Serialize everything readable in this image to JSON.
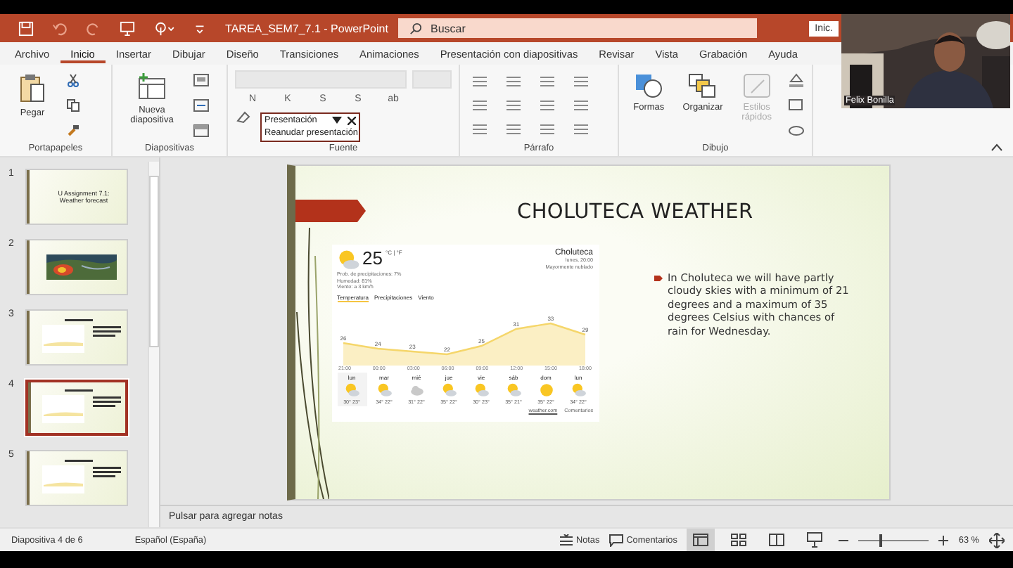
{
  "title_bar": {
    "title": "TAREA_SEM7_7.1 - PowerPoint",
    "search": {
      "placeholder": "Buscar"
    },
    "account_button": "Inic."
  },
  "menu_tabs": [
    {
      "label": "Archivo",
      "selected": false
    },
    {
      "label": "Inicio",
      "selected": true
    },
    {
      "label": "Insertar",
      "selected": false
    },
    {
      "label": "Dibujar",
      "selected": false
    },
    {
      "label": "Diseño",
      "selected": false
    },
    {
      "label": "Transiciones",
      "selected": false
    },
    {
      "label": "Animaciones",
      "selected": false
    },
    {
      "label": "Presentación con diapositivas",
      "selected": false
    },
    {
      "label": "Revisar",
      "selected": false
    },
    {
      "label": "Vista",
      "selected": false
    },
    {
      "label": "Grabación",
      "selected": false
    },
    {
      "label": "Ayuda",
      "selected": false
    }
  ],
  "ribbon": {
    "groups": [
      {
        "kind": "clipboard",
        "label": "Portapapeles",
        "big_button": "Pegar"
      },
      {
        "kind": "slides",
        "label": "Diapositivas",
        "big_button": "Nueva diapositiva"
      },
      {
        "kind": "font",
        "label": "Fuente",
        "buttons": [
          "N",
          "K",
          "S",
          "S",
          "ab"
        ]
      },
      {
        "kind": "paragraph",
        "label": "Párrafo"
      },
      {
        "kind": "drawing",
        "label": "Dibujo",
        "buttons": [
          "Formas",
          "Organizar",
          "Estilos rápidos"
        ]
      }
    ]
  },
  "presentation_popup": {
    "title": "Presentación",
    "item": "Reanudar presentación"
  },
  "webcam": {
    "name": "Felix Bonilla"
  },
  "thumbnails": [
    {
      "number": "1",
      "kind": "title",
      "title": "U Assignment 7.1: Weather forecast",
      "selected": false
    },
    {
      "number": "2",
      "kind": "map",
      "selected": false
    },
    {
      "number": "3",
      "kind": "weather",
      "selected": false
    },
    {
      "number": "4",
      "kind": "weather",
      "selected": true
    },
    {
      "number": "5",
      "kind": "weather",
      "selected": false
    }
  ],
  "slide": {
    "title": "CHOLUTECA WEATHER",
    "bullet": "In Choluteca we will have partly cloudy skies with a minimum  of 21 degrees and a maximum  of 35 degrees Celsius with chances of rain for Wednesday.",
    "weather": {
      "temperature": "25",
      "units": "°C | °F",
      "details": [
        "Prob. de precipitaciones: 7%",
        "Humedad: 81%",
        "Viento: a 3 km/h"
      ],
      "city": "Choluteca",
      "time": "lunes, 20:00",
      "condition": "Mayormente nublado",
      "tabs": [
        {
          "label": "Temperatura",
          "selected": true
        },
        {
          "label": "Precipitaciones",
          "selected": false
        },
        {
          "label": "Viento",
          "selected": false
        }
      ],
      "chart_data": {
        "type": "area",
        "categories": [
          "21:00",
          "00:00",
          "03:00",
          "06:00",
          "09:00",
          "12:00",
          "15:00",
          "18:00"
        ],
        "series": [
          {
            "color": "#f5d66a",
            "values": [
              26,
              24,
              23,
              22,
              25,
              31,
              33,
              29
            ]
          }
        ],
        "data_labels": true
      },
      "days": [
        {
          "day": "lun",
          "kind": "partly",
          "temps": "30° 23°",
          "selected": true
        },
        {
          "day": "mar",
          "kind": "partly",
          "temps": "34° 22°",
          "selected": false
        },
        {
          "day": "mié",
          "kind": "cloudy",
          "temps": "31° 22°",
          "selected": false
        },
        {
          "day": "jue",
          "kind": "partly",
          "temps": "35° 22°",
          "selected": false
        },
        {
          "day": "vie",
          "kind": "partly",
          "temps": "30° 23°",
          "selected": false
        },
        {
          "day": "sáb",
          "kind": "partly",
          "temps": "35° 21°",
          "selected": false
        },
        {
          "day": "dom",
          "kind": "sunny",
          "temps": "35° 22°",
          "selected": false
        },
        {
          "day": "lun",
          "kind": "partly",
          "temps": "34° 22°",
          "selected": false
        }
      ],
      "source": "weather.com",
      "feedback": "Comentarios"
    }
  },
  "notes": {
    "placeholder": "Pulsar para agregar notas"
  },
  "status_bar": {
    "slide": "Diapositiva 4 de 6",
    "language": "Español (España)",
    "notes": "Notas",
    "comments": "Comentarios",
    "zoom": {
      "level": 0.3,
      "reading": "63 %"
    }
  }
}
